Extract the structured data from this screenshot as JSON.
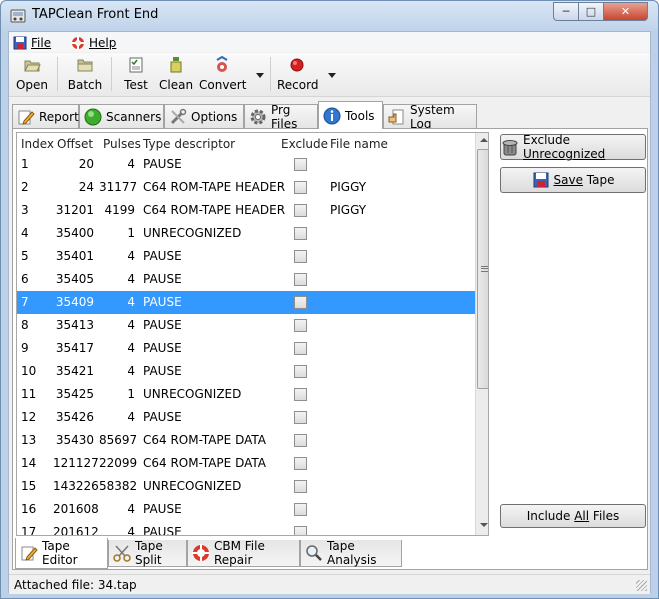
{
  "window": {
    "title": "TAPClean Front End",
    "minimize": "─",
    "maximize": "□",
    "close": "✕"
  },
  "menu": [
    {
      "label": "File",
      "icon": "floppy-icon"
    },
    {
      "label": "Help",
      "icon": "lifebuoy-icon"
    }
  ],
  "toolbar": {
    "open": "Open",
    "batch": "Batch",
    "test": "Test",
    "clean": "Clean",
    "convert": "Convert",
    "record": "Record"
  },
  "tabs": [
    {
      "label": "Report",
      "icon": "pencil-icon"
    },
    {
      "label": "Scanners",
      "icon": "green-circle-icon"
    },
    {
      "label": "Options",
      "icon": "tools-icon"
    },
    {
      "label": "Prg Files",
      "icon": "gear-icon"
    },
    {
      "label": "Tools",
      "icon": "info-icon",
      "active": true
    },
    {
      "label": "System Log",
      "icon": "hand-icon"
    }
  ],
  "table": {
    "headers": [
      "Index",
      "Offset",
      "Pulses",
      "Type descriptor",
      "Exclude",
      "File name"
    ],
    "selected_index": 6,
    "rows": [
      {
        "index": "1",
        "offset": "20",
        "pulses": "4",
        "type": "PAUSE",
        "file": ""
      },
      {
        "index": "2",
        "offset": "24",
        "pulses": "31177",
        "type": "C64 ROM-TAPE HEADER",
        "file": "PIGGY"
      },
      {
        "index": "3",
        "offset": "31201",
        "pulses": "4199",
        "type": "C64 ROM-TAPE HEADER",
        "file": "PIGGY"
      },
      {
        "index": "4",
        "offset": "35400",
        "pulses": "1",
        "type": "UNRECOGNIZED",
        "file": ""
      },
      {
        "index": "5",
        "offset": "35401",
        "pulses": "4",
        "type": "PAUSE",
        "file": ""
      },
      {
        "index": "6",
        "offset": "35405",
        "pulses": "4",
        "type": "PAUSE",
        "file": ""
      },
      {
        "index": "7",
        "offset": "35409",
        "pulses": "4",
        "type": "PAUSE",
        "file": ""
      },
      {
        "index": "8",
        "offset": "35413",
        "pulses": "4",
        "type": "PAUSE",
        "file": ""
      },
      {
        "index": "9",
        "offset": "35417",
        "pulses": "4",
        "type": "PAUSE",
        "file": ""
      },
      {
        "index": "10",
        "offset": "35421",
        "pulses": "4",
        "type": "PAUSE",
        "file": ""
      },
      {
        "index": "11",
        "offset": "35425",
        "pulses": "1",
        "type": "UNRECOGNIZED",
        "file": ""
      },
      {
        "index": "12",
        "offset": "35426",
        "pulses": "4",
        "type": "PAUSE",
        "file": ""
      },
      {
        "index": "13",
        "offset": "35430",
        "pulses": "85697",
        "type": "C64 ROM-TAPE DATA",
        "file": ""
      },
      {
        "index": "14",
        "offset": "121127",
        "pulses": "22099",
        "type": "C64 ROM-TAPE DATA",
        "file": ""
      },
      {
        "index": "15",
        "offset": "143226",
        "pulses": "58382",
        "type": "UNRECOGNIZED",
        "file": ""
      },
      {
        "index": "16",
        "offset": "201608",
        "pulses": "4",
        "type": "PAUSE",
        "file": ""
      },
      {
        "index": "17",
        "offset": "201612",
        "pulses": "4",
        "type": "PAUSE",
        "file": ""
      }
    ]
  },
  "side_buttons": {
    "exclude_pre": "Exclude ",
    "exclude_ul": "Unrecognized",
    "save_ul": "Save",
    "save_post": " Tape",
    "include_pre": "Include ",
    "include_ul": "All",
    "include_post": " Files"
  },
  "bottom_tabs": [
    {
      "label": "Tape Editor",
      "icon": "pencil-icon",
      "active": true
    },
    {
      "label": "Tape Split",
      "icon": "scissors-icon"
    },
    {
      "label": "CBM File Repair",
      "icon": "lifebuoy-icon"
    },
    {
      "label": "Tape Analysis",
      "icon": "magnifier-icon"
    }
  ],
  "status": {
    "text": "Attached file: 34.tap"
  },
  "colors": {
    "selection": "#3399ff",
    "record_red": "#d42020",
    "title_bar": "#c8d9ee"
  }
}
